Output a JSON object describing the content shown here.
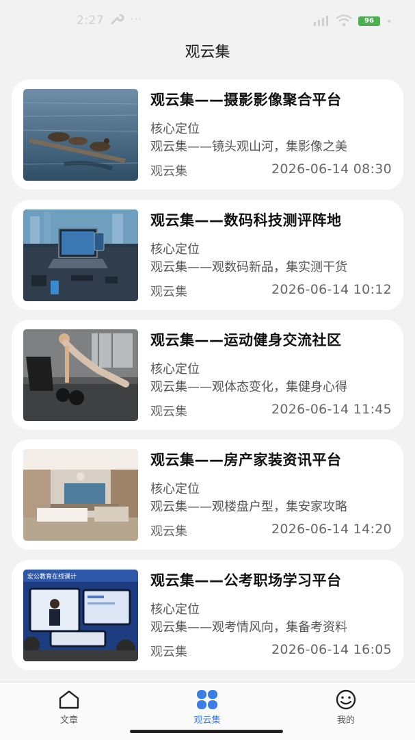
{
  "status_bar": {
    "time": "2:27",
    "battery": "96",
    "icons": [
      "wrench-icon",
      "more-dots-icon",
      "signal-icon",
      "wifi-icon",
      "battery-icon"
    ]
  },
  "header": {
    "title": "观云集"
  },
  "articles": [
    {
      "title": "观云集——摄影影像聚合平台",
      "subtitle": "核心定位",
      "description": "观云集——镜头观山河，集影像之美",
      "source": "观云集",
      "date": "2026-06-14 08:30"
    },
    {
      "title": "观云集——数码科技测评阵地",
      "subtitle": "核心定位",
      "description": "观云集——观数码新品，集实测干货",
      "source": "观云集",
      "date": "2026-06-14 10:12"
    },
    {
      "title": "观云集——运动健身交流社区",
      "subtitle": "核心定位",
      "description": "观云集——观体态变化，集健身心得",
      "source": "观云集",
      "date": "2026-06-14 11:45"
    },
    {
      "title": "观云集——房产家装资讯平台",
      "subtitle": "核心定位",
      "description": "观云集——观楼盘户型，集安家攻略",
      "source": "观云集",
      "date": "2026-06-14 14:20"
    },
    {
      "title": "观云集——公考职场学习平台",
      "subtitle": "核心定位",
      "description": "观云集——观考情风向，集备考资料",
      "source": "观云集",
      "date": "2026-06-14 16:05",
      "thumb_text": "宏公教育在线课计"
    }
  ],
  "tab_bar": {
    "tabs": [
      {
        "label": "文章",
        "icon": "home-icon"
      },
      {
        "label": "观云集",
        "icon": "four-petal-icon",
        "active": true
      },
      {
        "label": "我的",
        "icon": "smiley-icon"
      }
    ],
    "active_color": "#3b7fe6"
  }
}
